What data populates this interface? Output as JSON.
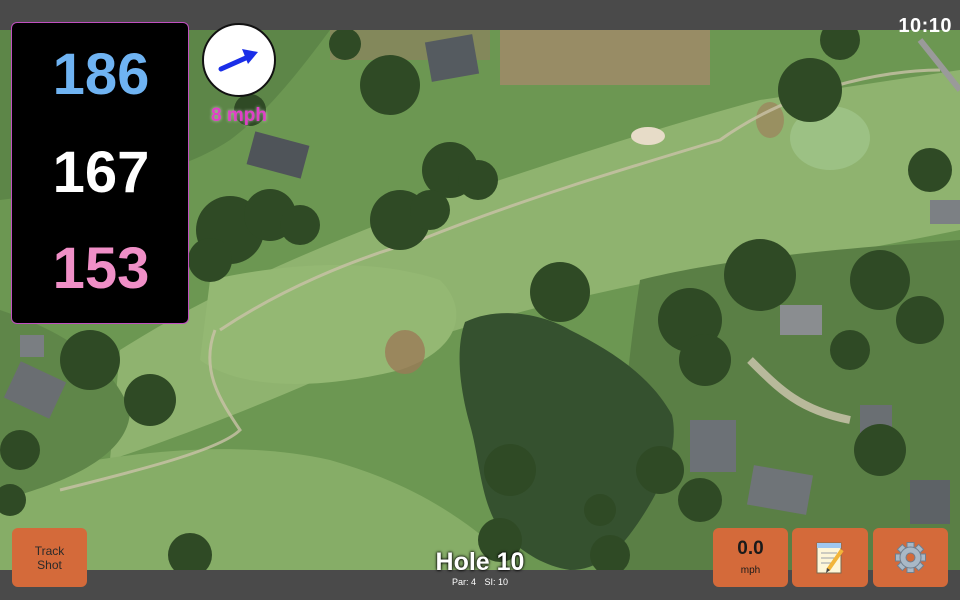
{
  "status": {
    "time": "10:10"
  },
  "yardages": {
    "back": "186",
    "middle": "167",
    "front": "153"
  },
  "wind": {
    "speed_label": "8 mph",
    "direction_icon": "wind-arrow-icon"
  },
  "hole": {
    "title": "Hole 10",
    "par_label": "Par: 4",
    "si_label": "SI: 10"
  },
  "buttons": {
    "track_shot_line1": "Track",
    "track_shot_line2": "Shot",
    "speed_value": "0.0",
    "speed_unit": "mph",
    "notes_icon": "notepad-icon",
    "settings_icon": "gear-icon"
  },
  "colors": {
    "back_yardage": "#6fb3f2",
    "middle_yardage": "#ffffff",
    "front_yardage": "#f08fc7",
    "wind_speed": "#e040c8",
    "button": "#d46a3a",
    "wind_arrow": "#1a2ee8"
  }
}
